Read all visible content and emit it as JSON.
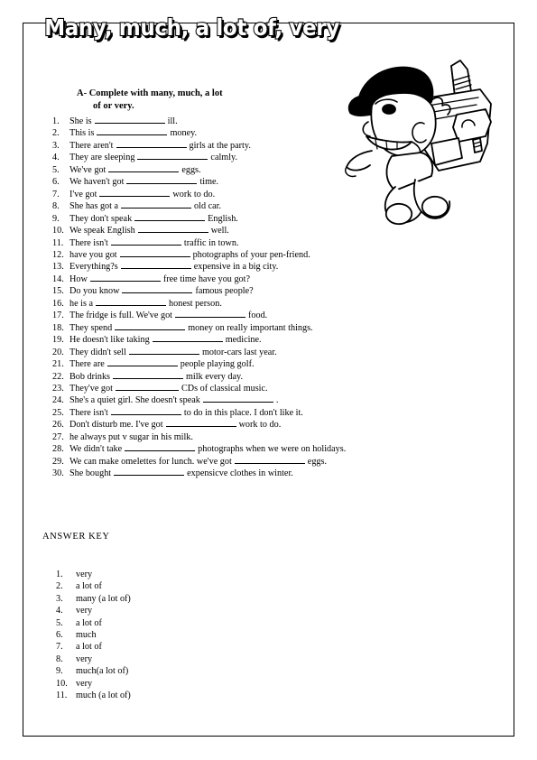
{
  "document": {
    "title": "Many, much, a lot of, very",
    "instruction_line1": "A- Complete with many, much, a lot",
    "instruction_line2": "of or very.",
    "illustration_name": "cartoon-boy-with-backpack-and-pencil"
  },
  "questions": [
    {
      "num": "1.",
      "before": "She is",
      "blank": "long",
      "after": "ill."
    },
    {
      "num": "2.",
      "before": "This is",
      "blank": "long",
      "after": "money."
    },
    {
      "num": "3.",
      "before": "There aren't",
      "blank": "long",
      "after": "girls at the party."
    },
    {
      "num": "4.",
      "before": "They are sleeping",
      "blank": "long",
      "after": "calmly."
    },
    {
      "num": "5.",
      "before": "We've got",
      "blank": "long",
      "after": "eggs."
    },
    {
      "num": "6.",
      "before": "We haven't got",
      "blank": "long",
      "after": "time."
    },
    {
      "num": "7.",
      "before": "I've got",
      "blank": "long",
      "after": "work to do."
    },
    {
      "num": "8.",
      "before": "She has got a",
      "blank": "long",
      "after": "old car."
    },
    {
      "num": "9.",
      "before": "They don't speak",
      "blank": "long",
      "after": "English."
    },
    {
      "num": "10.",
      "before": "We speak English",
      "blank": "long",
      "after": "well."
    },
    {
      "num": "11.",
      "before": "There isn't",
      "blank": "long",
      "after": "traffic in town."
    },
    {
      "num": "12.",
      "before": "have you got",
      "blank": "long",
      "after": "photographs of your pen-friend."
    },
    {
      "num": "13.",
      "before": "Everything?s",
      "blank": "long",
      "after": "expensive in a big city."
    },
    {
      "num": "14.",
      "before": "How",
      "blank": "long",
      "after": "free time have you got?"
    },
    {
      "num": "15.",
      "before": "Do you know",
      "blank": "long",
      "after": "famous people?"
    },
    {
      "num": "16.",
      "before": "he is a",
      "blank": "long",
      "after": "honest person."
    },
    {
      "num": "17.",
      "before": "The fridge is full. We've got",
      "blank": "long",
      "after": "food."
    },
    {
      "num": "18.",
      "before": "They spend",
      "blank": "long",
      "after": "money on really important things."
    },
    {
      "num": "19.",
      "before": "He doesn't like taking",
      "blank": "long",
      "after": "medicine."
    },
    {
      "num": "20.",
      "before": "They didn't sell",
      "blank": "long",
      "after": "motor-cars last year."
    },
    {
      "num": "21.",
      "before": "There are",
      "blank": "long",
      "after": "people playing golf."
    },
    {
      "num": "22.",
      "before": "Bob drinks",
      "blank": "long",
      "after": "milk every day."
    },
    {
      "num": "23.",
      "before": "They've got",
      "blank": "short",
      "after": "CDs of classical music."
    },
    {
      "num": "24.",
      "before": "She's a quiet girl. She doesn't speak",
      "blank": "long",
      "after": "."
    },
    {
      "num": "25.",
      "before": "There isn't",
      "blank": "long",
      "after": "to do in this place. I don't like it."
    },
    {
      "num": "26.",
      "before": "Don't disturb me. I've got",
      "blank": "long",
      "after": "work to do."
    },
    {
      "num": "27.",
      "before": "he always put v sugar in his milk.",
      "blank": "none",
      "after": ""
    },
    {
      "num": "28.",
      "before": "We didn't take",
      "blank": "long",
      "after": "photographs when we were on holidays."
    },
    {
      "num": "29.",
      "before": "We can make omelettes for lunch. we've got",
      "blank": "long",
      "after": "eggs."
    },
    {
      "num": "30.",
      "before": "She bought",
      "blank": "long",
      "after": "expensicve clothes in winter."
    }
  ],
  "answer_key": {
    "heading": "ANSWER KEY",
    "items": [
      {
        "num": "1.",
        "answer": "very"
      },
      {
        "num": "2.",
        "answer": "a lot of"
      },
      {
        "num": "3.",
        "answer": "many (a lot of)"
      },
      {
        "num": "4.",
        "answer": "very"
      },
      {
        "num": "5.",
        "answer": "a lot of"
      },
      {
        "num": "6.",
        "answer": "much"
      },
      {
        "num": "7.",
        "answer": "a lot of"
      },
      {
        "num": "8.",
        "answer": "very"
      },
      {
        "num": "9.",
        "answer": "much(a lot of)"
      },
      {
        "num": "10.",
        "answer": "very"
      },
      {
        "num": "11.",
        "answer": "much (a lot of)"
      }
    ]
  }
}
